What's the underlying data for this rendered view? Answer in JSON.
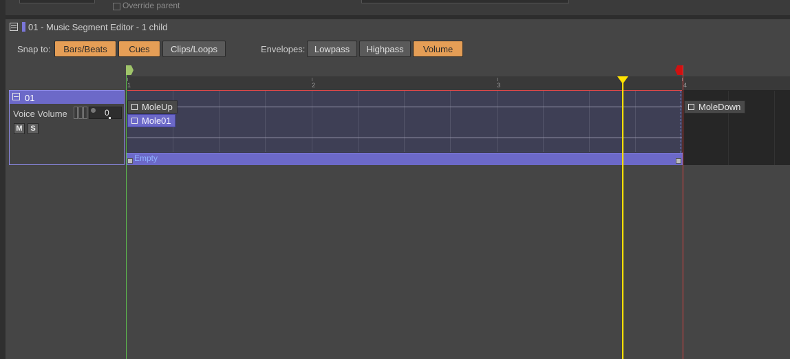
{
  "panel_top": {
    "override_label": "Override parent"
  },
  "title": {
    "text": "01 - Music Segment Editor - 1 child",
    "accent_color": "#7a76d8"
  },
  "toolbar": {
    "snap_label": "Snap to:",
    "snap_buttons": [
      {
        "label": "Bars/Beats",
        "active": true
      },
      {
        "label": "Cues",
        "active": true
      },
      {
        "label": "Clips/Loops",
        "active": false
      }
    ],
    "envelopes_label": "Envelopes:",
    "envelope_buttons": [
      {
        "label": "Lowpass",
        "active": false
      },
      {
        "label": "Highpass",
        "active": false
      },
      {
        "label": "Volume",
        "active": true
      }
    ],
    "active_color": "#e59e56"
  },
  "track": {
    "name": "01",
    "property_label": "Voice Volume",
    "volume_value": "0",
    "mute_label": "M",
    "solo_label": "S"
  },
  "timeline": {
    "bar_numbers": [
      "1",
      "2",
      "3",
      "4"
    ],
    "clips": [
      {
        "label": "MoleUp",
        "selected": false
      },
      {
        "label": "Mole01",
        "selected": true
      },
      {
        "label": "MoleDown",
        "selected": false
      }
    ],
    "automation_lane_label": "Empty",
    "markers": {
      "entry_color": "#9fc46a",
      "play_cursor_color": "#ffe300",
      "exit_color": "#d11010"
    }
  }
}
